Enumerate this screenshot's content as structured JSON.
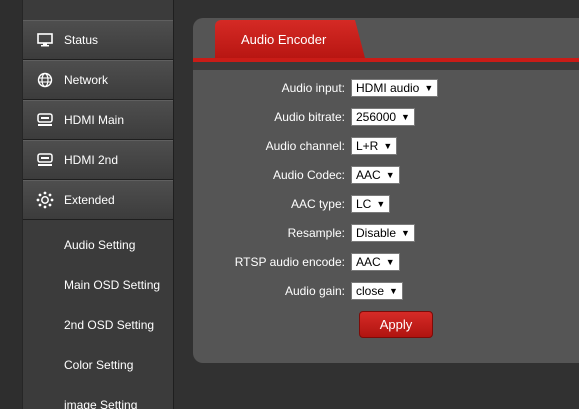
{
  "sidebar": {
    "menu": [
      {
        "label": "Status",
        "icon": "monitor-icon"
      },
      {
        "label": "Network",
        "icon": "globe-icon"
      },
      {
        "label": "HDMI Main",
        "icon": "hdmi-device-icon"
      },
      {
        "label": "HDMI 2nd",
        "icon": "hdmi-device-icon"
      },
      {
        "label": "Extended",
        "icon": "gear-icon"
      }
    ],
    "submenu": [
      {
        "label": "Audio Setting"
      },
      {
        "label": "Main OSD Setting"
      },
      {
        "label": "2nd OSD Setting"
      },
      {
        "label": "Color Setting"
      },
      {
        "label": "image Setting"
      }
    ]
  },
  "panel": {
    "tab_title": "Audio Encoder",
    "fields": [
      {
        "label": "Audio input:",
        "value": "HDMI audio"
      },
      {
        "label": "Audio bitrate:",
        "value": "256000"
      },
      {
        "label": "Audio channel:",
        "value": "L+R"
      },
      {
        "label": "Audio Codec:",
        "value": "AAC"
      },
      {
        "label": "AAC type:",
        "value": "LC"
      },
      {
        "label": "Resample:",
        "value": "Disable"
      },
      {
        "label": "RTSP audio encode:",
        "value": "AAC"
      },
      {
        "label": "Audio gain:",
        "value": "close"
      }
    ],
    "apply_label": "Apply"
  },
  "colors": {
    "accent": "#c91c17",
    "panel_bg": "#555555",
    "page_bg": "#313131"
  }
}
